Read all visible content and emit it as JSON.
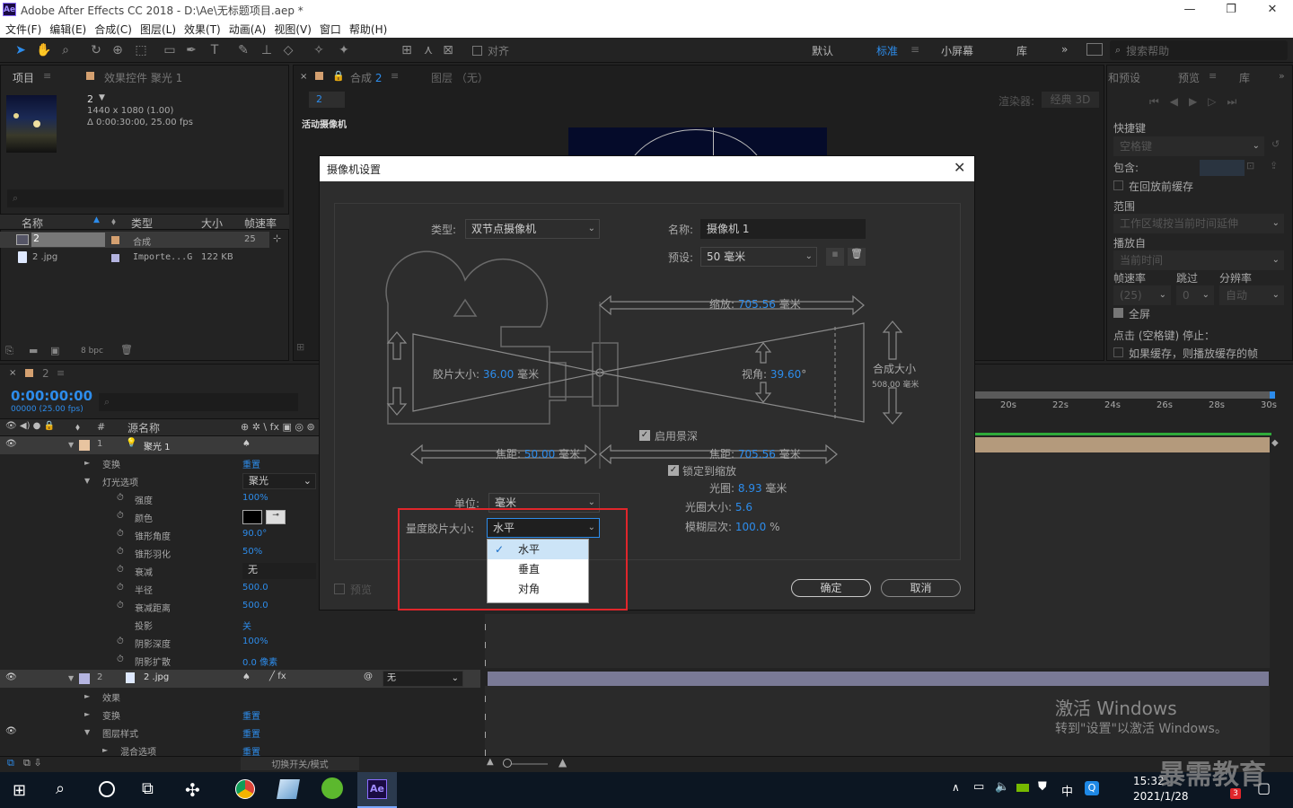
{
  "window": {
    "title": "Adobe After Effects CC 2018 - D:\\Ae\\无标题项目.aep *",
    "app_badge": "Ae",
    "min": "—",
    "restore": "❐",
    "close": "✕"
  },
  "menu": [
    "文件(F)",
    "编辑(E)",
    "合成(C)",
    "图层(L)",
    "效果(T)",
    "动画(A)",
    "视图(V)",
    "窗口",
    "帮助(H)"
  ],
  "toolbar": {
    "snap_label": "对齐",
    "workspaces": [
      "默认",
      "标准",
      "小屏幕",
      "库"
    ],
    "active_workspace": "标准",
    "search_placeholder": "搜索帮助",
    "more": "»"
  },
  "project": {
    "tab_project": "项目",
    "tab_effects": "效果控件 聚光 1",
    "item_name": "2",
    "item_info1": "1440 x 1080 (1.00)",
    "item_info2": "Δ 0:00:30:00, 25.00 fps",
    "columns": [
      "名称",
      "类型",
      "大小",
      "帧速率"
    ],
    "rows": [
      {
        "name": "2",
        "type": "合成",
        "size": "",
        "fps": "25"
      },
      {
        "name": "2 .jpg",
        "type": "Importe...G",
        "size": "122 KB",
        "fps": ""
      }
    ],
    "bpc": "8 bpc"
  },
  "comp": {
    "tab": "合成 2",
    "layer_tab": "图层 （无）",
    "comp_chip": "2",
    "renderer_label": "渲染器:",
    "renderer": "经典 3D",
    "active_camera": "活动摄像机"
  },
  "preview": {
    "tab_effects": "和预设",
    "tab_preview": "预览",
    "tab_lib": "库",
    "shortcut_label": "快捷键",
    "shortcut": "空格键",
    "include_label": "包含:",
    "cache_before": "在回放前缓存",
    "range_label": "范围",
    "range": "工作区域按当前时间延伸",
    "play_from_label": "播放自",
    "play_from": "当前时间",
    "fps_label": "帧速率",
    "skip_label": "跳过",
    "res_label": "分辨率",
    "fps": "(25)",
    "skip": "0",
    "res": "自动",
    "fullscreen": "全屏",
    "stop_hint": "点击 (空格键) 停止：",
    "cache_hint": "如果缓存，则播放缓存的帧"
  },
  "timeline": {
    "tab": "2",
    "timecode": "0:00:00:00",
    "frames": "00000 (25.00 fps)",
    "col_source": "源名称",
    "layer1": {
      "num": "1",
      "name": "聚光 1"
    },
    "layer2": {
      "num": "2",
      "name": "2 .jpg",
      "parent": "无"
    },
    "rows": [
      {
        "label": "变换",
        "value": "重置"
      },
      {
        "label": "灯光选项",
        "value": "聚光"
      },
      {
        "label": "强度",
        "value": "100%"
      },
      {
        "label": "颜色",
        "value": ""
      },
      {
        "label": "锥形角度",
        "value": "90.0°"
      },
      {
        "label": "锥形羽化",
        "value": "50%"
      },
      {
        "label": "衰减",
        "value": "无"
      },
      {
        "label": "半径",
        "value": "500.0"
      },
      {
        "label": "衰减距离",
        "value": "500.0"
      },
      {
        "label": "投影",
        "value": "关"
      },
      {
        "label": "阴影深度",
        "value": "100%"
      },
      {
        "label": "阴影扩散",
        "value": "0.0 像素"
      }
    ],
    "rows2": [
      {
        "label": "效果",
        "value": ""
      },
      {
        "label": "变换",
        "value": "重置"
      },
      {
        "label": "图层样式",
        "value": "重置"
      },
      {
        "label": "混合选项",
        "value": "重置"
      }
    ],
    "ruler": [
      "20s",
      "22s",
      "24s",
      "26s",
      "28s",
      "30s"
    ],
    "switch_mode": "切换开关/模式"
  },
  "dialog": {
    "title": "摄像机设置",
    "type_label": "类型:",
    "type": "双节点摄像机",
    "name_label": "名称:",
    "name": "摄像机 1",
    "preset_label": "预设:",
    "preset": "50 毫米",
    "zoom_label": "缩放:",
    "zoom": "705.56",
    "unit_mm": "毫米",
    "film_label": "胶片大小:",
    "film": "36.00",
    "view_label": "视角:",
    "view": "39.60",
    "deg": "°",
    "comp_size_label": "合成大小",
    "comp_size": "508.00 毫米",
    "dof": "启用景深",
    "focal_label": "焦距:",
    "focal": "50.00",
    "focus_label": "焦距:",
    "focus": "705.56",
    "lock_zoom": "锁定到缩放",
    "aperture_label": "光圈:",
    "aperture": "8.93",
    "fstop_label": "光圈大小:",
    "fstop": "5.6",
    "blur_label": "模糊层次:",
    "blur": "100.0",
    "pct": "%",
    "unit_label": "单位:",
    "unit": "毫米",
    "measure_label": "量度胶片大小:",
    "measure": "水平",
    "options": [
      "水平",
      "垂直",
      "对角"
    ],
    "preview": "预览",
    "ok": "确定",
    "cancel": "取消"
  },
  "watermark": {
    "line1": "激活 Windows",
    "line2": "转到\"设置\"以激活 Windows。",
    "brand": "暴需教育"
  },
  "taskbar": {
    "time": "15:32",
    "date": "2021/1/28",
    "ime": "中",
    "badge": "3",
    "ae": "Ae"
  }
}
